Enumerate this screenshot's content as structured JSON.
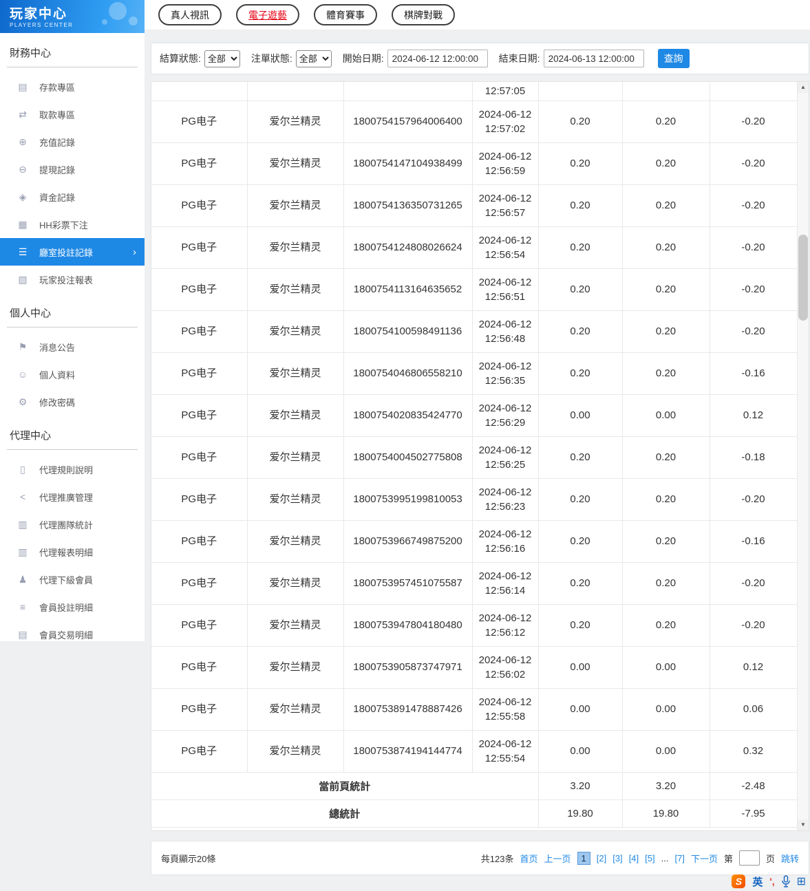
{
  "colors": {
    "accent": "#1e88e5",
    "active_tab_text": "#e60012",
    "sidebar_header_blue": "#1a7fd8",
    "sogou_orange": "#f55b00"
  },
  "sidebar": {
    "title": "玩家中心",
    "subtitle": "PLAYERS CENTER",
    "sections": [
      {
        "label": "財務中心",
        "items": [
          {
            "name": "deposit",
            "icon_name": "deposit-card-icon",
            "icon": "▤",
            "label": "存款專區"
          },
          {
            "name": "withdraw",
            "icon_name": "withdraw-icon",
            "icon": "⇄",
            "label": "取款專區"
          },
          {
            "name": "recharge-records",
            "icon_name": "recharge-record-icon",
            "icon": "⊕",
            "label": "充值記錄"
          },
          {
            "name": "withdrawal-records",
            "icon_name": "withdrawal-record-icon",
            "icon": "⊖",
            "label": "提現記錄"
          },
          {
            "name": "funds-records",
            "icon_name": "funds-record-icon",
            "icon": "◈",
            "label": "資金記錄"
          },
          {
            "name": "hh-lottery-bets",
            "icon_name": "lottery-bet-icon",
            "icon": "▦",
            "label": "HH彩票下注"
          },
          {
            "name": "room-bet-records",
            "icon_name": "room-bet-record-icon",
            "icon": "☰",
            "label": "廳室投註記錄",
            "active": true
          },
          {
            "name": "player-bet-report",
            "icon_name": "player-bet-report-icon",
            "icon": "▧",
            "label": "玩家投注報表"
          }
        ]
      },
      {
        "label": "個人中心",
        "items": [
          {
            "name": "announcements",
            "icon_name": "bell-icon",
            "icon": "⚑",
            "label": "消息公告"
          },
          {
            "name": "profile",
            "icon_name": "user-icon",
            "icon": "☺",
            "label": "個人資料"
          },
          {
            "name": "change-password",
            "icon_name": "gear-icon",
            "icon": "⚙",
            "label": "修改密碼"
          }
        ]
      },
      {
        "label": "代理中心",
        "items": [
          {
            "name": "agent-rules",
            "icon_name": "document-icon",
            "icon": "▯",
            "label": "代理規則說明"
          },
          {
            "name": "agent-promotion",
            "icon_name": "share-icon",
            "icon": "<",
            "label": "代理推廣管理"
          },
          {
            "name": "agent-team-stats",
            "icon_name": "bar-chart-icon",
            "icon": "▥",
            "label": "代理團隊統計"
          },
          {
            "name": "agent-report-detail",
            "icon_name": "report-chart-icon",
            "icon": "▥",
            "label": "代理報表明細"
          },
          {
            "name": "agent-sub-members",
            "icon_name": "users-icon",
            "icon": "♟",
            "label": "代理下級會員"
          },
          {
            "name": "member-bet-detail",
            "icon_name": "list-document-icon",
            "icon": "≡",
            "label": "會員投註明細"
          },
          {
            "name": "member-transaction-detail",
            "icon_name": "ledger-icon",
            "icon": "▤",
            "label": "會員交易明細"
          }
        ]
      }
    ]
  },
  "tabs": [
    {
      "name": "live-casino",
      "label": "真人視訊"
    },
    {
      "name": "electronic-games",
      "label": "電子遊藝",
      "active": true
    },
    {
      "name": "sports",
      "label": "體育賽事"
    },
    {
      "name": "board-games",
      "label": "棋牌對戰"
    }
  ],
  "filters": {
    "settle_status_label": "結算狀態:",
    "settle_status_value": "全部",
    "order_status_label": "注單狀態:",
    "order_status_value": "全部",
    "start_date_label": "開始日期:",
    "start_date_value": "2024-06-12 12:00:00",
    "end_date_label": "結束日期:",
    "end_date_value": "2024-06-13 12:00:00",
    "search_label": "查詢"
  },
  "table": {
    "partial_row_time": "12:57:05",
    "rows": [
      {
        "platform": "PG电子",
        "game": "爱尔兰精灵",
        "order_id": "1800754157964006400",
        "date": "2024-06-12",
        "time": "12:57:02",
        "bet": "0.20",
        "valid": "0.20",
        "profit": "-0.20"
      },
      {
        "platform": "PG电子",
        "game": "爱尔兰精灵",
        "order_id": "1800754147104938499",
        "date": "2024-06-12",
        "time": "12:56:59",
        "bet": "0.20",
        "valid": "0.20",
        "profit": "-0.20"
      },
      {
        "platform": "PG电子",
        "game": "爱尔兰精灵",
        "order_id": "1800754136350731265",
        "date": "2024-06-12",
        "time": "12:56:57",
        "bet": "0.20",
        "valid": "0.20",
        "profit": "-0.20"
      },
      {
        "platform": "PG电子",
        "game": "爱尔兰精灵",
        "order_id": "1800754124808026624",
        "date": "2024-06-12",
        "time": "12:56:54",
        "bet": "0.20",
        "valid": "0.20",
        "profit": "-0.20"
      },
      {
        "platform": "PG电子",
        "game": "爱尔兰精灵",
        "order_id": "1800754113164635652",
        "date": "2024-06-12",
        "time": "12:56:51",
        "bet": "0.20",
        "valid": "0.20",
        "profit": "-0.20"
      },
      {
        "platform": "PG电子",
        "game": "爱尔兰精灵",
        "order_id": "1800754100598491136",
        "date": "2024-06-12",
        "time": "12:56:48",
        "bet": "0.20",
        "valid": "0.20",
        "profit": "-0.20"
      },
      {
        "platform": "PG电子",
        "game": "爱尔兰精灵",
        "order_id": "1800754046806558210",
        "date": "2024-06-12",
        "time": "12:56:35",
        "bet": "0.20",
        "valid": "0.20",
        "profit": "-0.16"
      },
      {
        "platform": "PG电子",
        "game": "爱尔兰精灵",
        "order_id": "1800754020835424770",
        "date": "2024-06-12",
        "time": "12:56:29",
        "bet": "0.00",
        "valid": "0.00",
        "profit": "0.12"
      },
      {
        "platform": "PG电子",
        "game": "爱尔兰精灵",
        "order_id": "1800754004502775808",
        "date": "2024-06-12",
        "time": "12:56:25",
        "bet": "0.20",
        "valid": "0.20",
        "profit": "-0.18"
      },
      {
        "platform": "PG电子",
        "game": "爱尔兰精灵",
        "order_id": "1800753995199810053",
        "date": "2024-06-12",
        "time": "12:56:23",
        "bet": "0.20",
        "valid": "0.20",
        "profit": "-0.20"
      },
      {
        "platform": "PG电子",
        "game": "爱尔兰精灵",
        "order_id": "1800753966749875200",
        "date": "2024-06-12",
        "time": "12:56:16",
        "bet": "0.20",
        "valid": "0.20",
        "profit": "-0.16"
      },
      {
        "platform": "PG电子",
        "game": "爱尔兰精灵",
        "order_id": "1800753957451075587",
        "date": "2024-06-12",
        "time": "12:56:14",
        "bet": "0.20",
        "valid": "0.20",
        "profit": "-0.20"
      },
      {
        "platform": "PG电子",
        "game": "爱尔兰精灵",
        "order_id": "1800753947804180480",
        "date": "2024-06-12",
        "time": "12:56:12",
        "bet": "0.20",
        "valid": "0.20",
        "profit": "-0.20"
      },
      {
        "platform": "PG电子",
        "game": "爱尔兰精灵",
        "order_id": "1800753905873747971",
        "date": "2024-06-12",
        "time": "12:56:02",
        "bet": "0.00",
        "valid": "0.00",
        "profit": "0.12"
      },
      {
        "platform": "PG电子",
        "game": "爱尔兰精灵",
        "order_id": "1800753891478887426",
        "date": "2024-06-12",
        "time": "12:55:58",
        "bet": "0.00",
        "valid": "0.00",
        "profit": "0.06"
      },
      {
        "platform": "PG电子",
        "game": "爱尔兰精灵",
        "order_id": "1800753874194144774",
        "date": "2024-06-12",
        "time": "12:55:54",
        "bet": "0.00",
        "valid": "0.00",
        "profit": "0.32"
      }
    ],
    "page_summary": {
      "label": "當前頁統計",
      "bet": "3.20",
      "valid": "3.20",
      "profit": "-2.48"
    },
    "total_summary": {
      "label": "總統計",
      "bet": "19.80",
      "valid": "19.80",
      "profit": "-7.95"
    }
  },
  "pagination": {
    "per_page_label": "每頁顯示20條",
    "items": [
      {
        "name": "total-count-label",
        "label": "共123条",
        "type": "text"
      },
      {
        "name": "page-link-first",
        "label": "首页",
        "type": "link"
      },
      {
        "name": "page-link-prev",
        "label": "上一页",
        "type": "link"
      },
      {
        "name": "page-current",
        "label": "1",
        "type": "current"
      },
      {
        "name": "page-link-2",
        "label": "[2]",
        "type": "link"
      },
      {
        "name": "page-link-3",
        "label": "[3]",
        "type": "link"
      },
      {
        "name": "page-link-4",
        "label": "[4]",
        "type": "link"
      },
      {
        "name": "page-link-5",
        "label": "[5]",
        "type": "link"
      },
      {
        "name": "page-ellipsis",
        "label": "...",
        "type": "text"
      },
      {
        "name": "page-link-7",
        "label": "[7]",
        "type": "link"
      },
      {
        "name": "page-link-next",
        "label": "下一页",
        "type": "link"
      },
      {
        "name": "jump-prefix-label",
        "label": "第",
        "type": "text"
      },
      {
        "name": "page-jump-input",
        "type": "input"
      },
      {
        "name": "jump-suffix-label",
        "label": "页",
        "type": "text"
      },
      {
        "name": "jump-button",
        "label": "跳转",
        "type": "link"
      }
    ]
  },
  "ime": {
    "logo": "S",
    "mode": "英",
    "punct": "',",
    "grid": "⊞"
  }
}
